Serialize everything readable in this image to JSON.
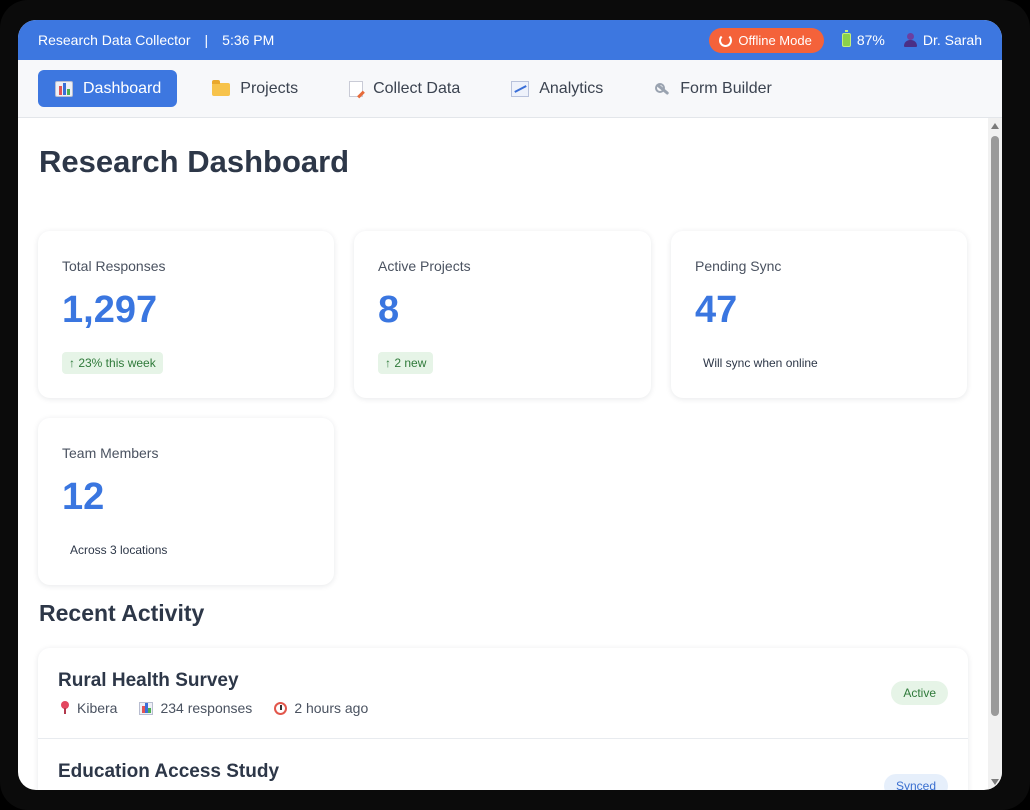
{
  "status_bar": {
    "app_title": "Research Data Collector",
    "separator": "|",
    "time": "5:36 PM",
    "offline_label": "Offline Mode",
    "battery": "87%",
    "user": "Dr. Sarah"
  },
  "nav": {
    "tabs": [
      {
        "label": "Dashboard",
        "icon": "bar-chart-icon",
        "active": true
      },
      {
        "label": "Projects",
        "icon": "folder-icon",
        "active": false
      },
      {
        "label": "Collect Data",
        "icon": "memo-icon",
        "active": false
      },
      {
        "label": "Analytics",
        "icon": "trend-chart-icon",
        "active": false
      },
      {
        "label": "Form Builder",
        "icon": "wrench-icon",
        "active": false
      }
    ]
  },
  "dashboard": {
    "title": "Research Dashboard",
    "stats": [
      {
        "label": "Total Responses",
        "value": "1,297",
        "badge": "↑ 23% this week"
      },
      {
        "label": "Active Projects",
        "value": "8",
        "badge": "↑ 2 new"
      },
      {
        "label": "Pending Sync",
        "value": "47",
        "note": "Will sync when online"
      },
      {
        "label": "Team Members",
        "value": "12",
        "note": "Across 3 locations"
      }
    ],
    "recent_title": "Recent Activity",
    "activity": [
      {
        "title": "Rural Health Survey",
        "location": "Kibera",
        "responses": "234 responses",
        "time": "2 hours ago",
        "status": "Active"
      },
      {
        "title": "Education Access Study",
        "status": "Synced"
      }
    ]
  },
  "colors": {
    "primary": "#3d77e0",
    "offline": "#f4623a",
    "success_bg": "#e6f4e7",
    "success_text": "#2f7a3a",
    "text_dark": "#2d3748"
  }
}
